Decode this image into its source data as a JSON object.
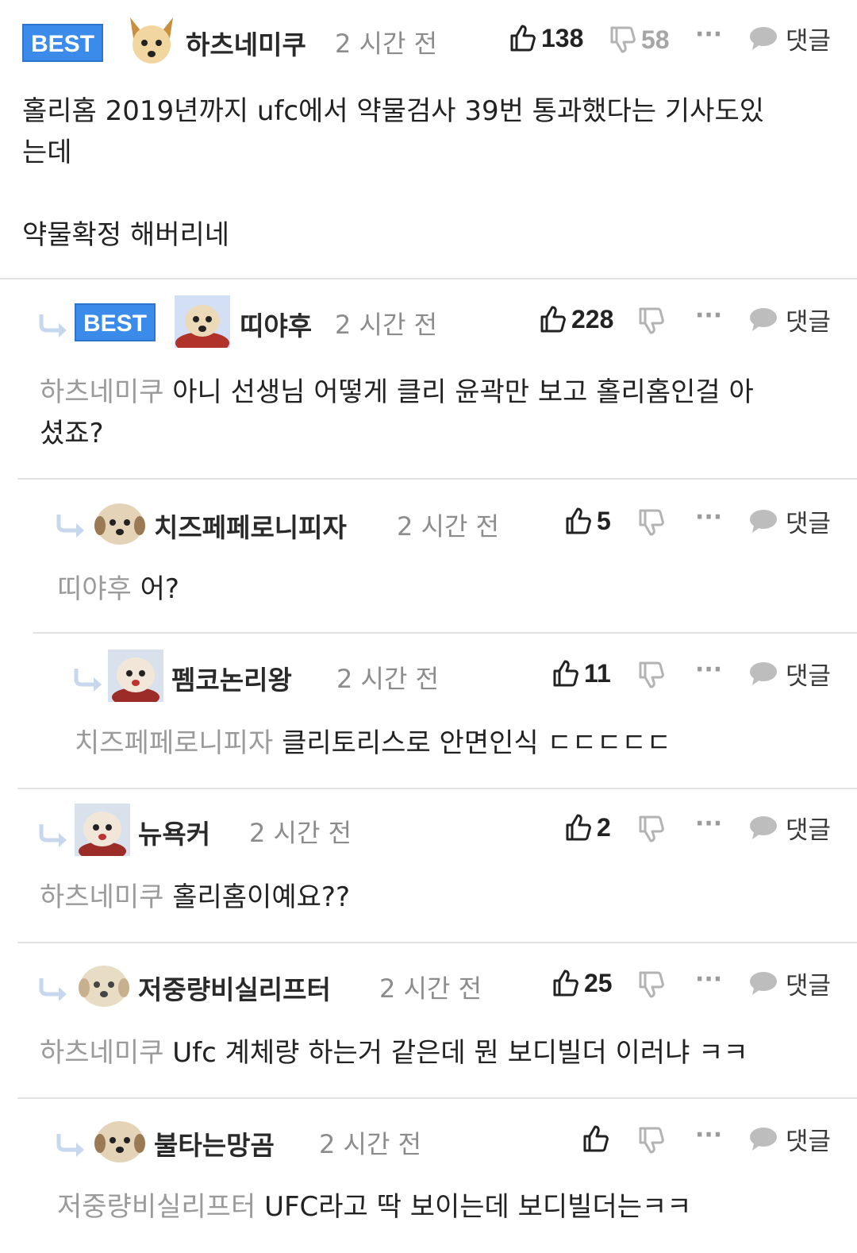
{
  "labels": {
    "best": "BEST",
    "reply": "댓글",
    "more": "···"
  },
  "colors": {
    "best_badge": "#3b8beb",
    "mention": "#9a9a9a",
    "divider": "#e2e2e2"
  },
  "comments": [
    {
      "author": "하츠네미쿠",
      "time": "2 시간 전",
      "likes": "138",
      "dislikes": "58",
      "mention": "",
      "text": "홀리홈 2019년까지 ufc에서 약물검사 39번 통과했다는 기사도있\n는데\n\n약물확정 해버리네"
    },
    {
      "author": "띠야후",
      "time": "2 시간 전",
      "likes": "228",
      "dislikes": "",
      "mention": "하츠네미쿠",
      "text": "아니 선생님 어떻게 클리 윤곽만 보고 홀리홈인걸 아\n셨죠?"
    },
    {
      "author": "치즈페페로니피자",
      "time": "2 시간 전",
      "likes": "5",
      "dislikes": "",
      "mention": "띠야후",
      "text": "어?"
    },
    {
      "author": "펨코논리왕",
      "time": "2 시간 전",
      "likes": "11",
      "dislikes": "",
      "mention": "치즈페페로니피자",
      "text": "클리토리스로 안면인식 ㄷㄷㄷㄷㄷ"
    },
    {
      "author": "뉴욕커",
      "time": "2 시간 전",
      "likes": "2",
      "dislikes": "",
      "mention": "하츠네미쿠",
      "text": "홀리홈이예요??"
    },
    {
      "author": "저중량비실리프터",
      "time": "2 시간 전",
      "likes": "25",
      "dislikes": "",
      "mention": "하츠네미쿠",
      "text": "Ufc 계체량 하는거 같은데 뭔 보디빌더 이러냐 ㅋㅋ"
    },
    {
      "author": "불타는망곰",
      "time": "2 시간 전",
      "likes": "",
      "dislikes": "",
      "mention": "저중량비실리프터",
      "text": "UFC라고 딱 보이는데 보디빌더는ㅋㅋ"
    }
  ]
}
